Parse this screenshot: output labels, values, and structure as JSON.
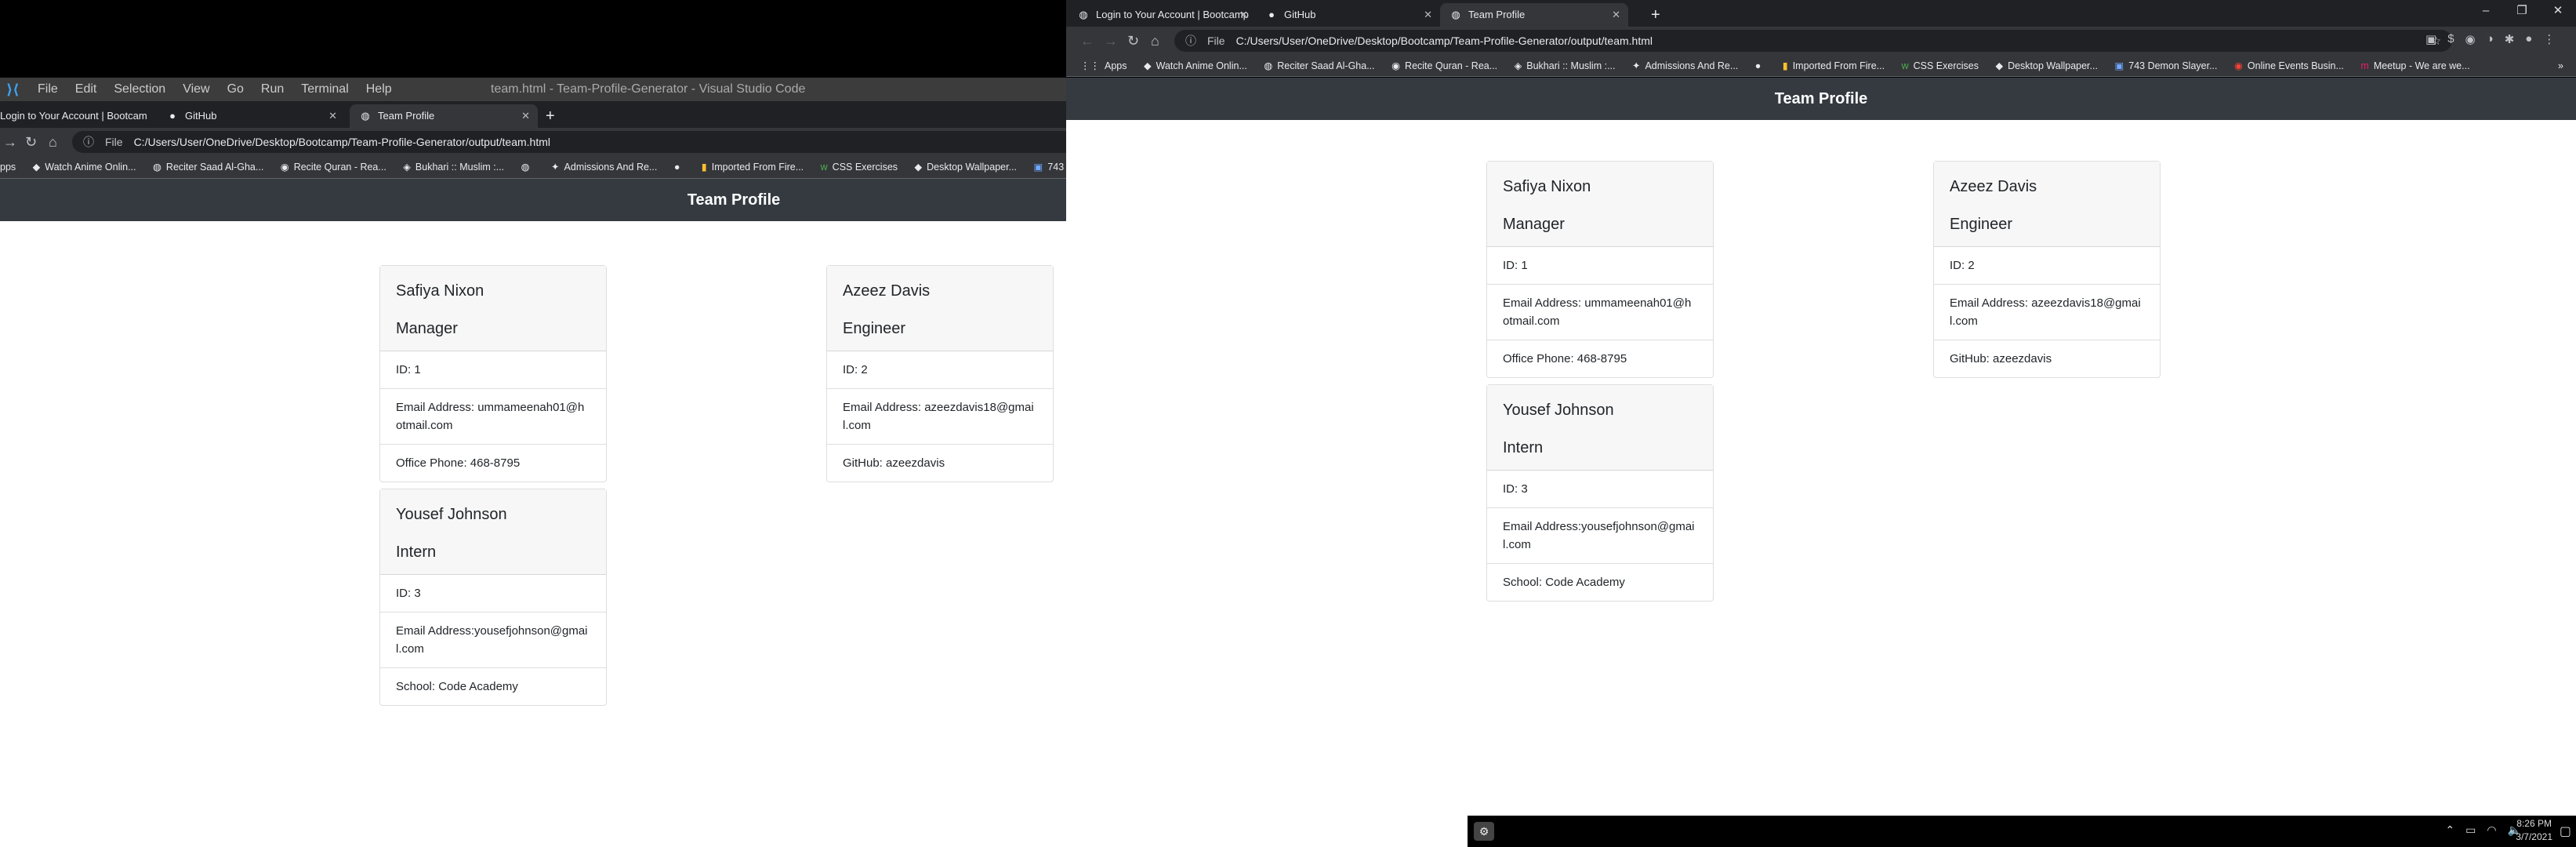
{
  "vscode": {
    "menu": [
      "File",
      "Edit",
      "Selection",
      "View",
      "Go",
      "Run",
      "Terminal",
      "Help"
    ],
    "title": "team.html - Team-Profile-Generator - Visual Studio Code"
  },
  "browser": {
    "tabs": [
      {
        "label": "Login to Your Account | Bootcamp",
        "icon": "bootcamp-icon"
      },
      {
        "label": "GitHub",
        "icon": "github-icon"
      },
      {
        "label": "Team Profile",
        "icon": "globe-icon"
      }
    ],
    "url_scheme": "File",
    "url": "C:/Users/User/OneDrive/Desktop/Bootcamp/Team-Profile-Generator/output/team.html",
    "bookmarks": [
      "Apps",
      "Watch Anime Onlin...",
      "Reciter Saad Al-Gha...",
      "Recite Quran - Rea...",
      "Bukhari :: Muslim :...",
      "",
      "Admissions And Re...",
      "",
      "Imported From Fire...",
      "CSS Exercises",
      "Desktop Wallpaper...",
      "743 Demon Slayer...",
      "Online Events Busin...",
      "Meetup - We are we..."
    ]
  },
  "page": {
    "header": "Team Profile",
    "cards": [
      {
        "name": "Safiya Nixon",
        "role": "Manager",
        "id": "ID: 1",
        "email": "Email Address: ummameenah01@hotmail.com",
        "extra": "Office Phone: 468-8795"
      },
      {
        "name": "Azeez Davis",
        "role": "Engineer",
        "id": "ID: 2",
        "email": "Email Address: azeezdavis18@gmail.com",
        "extra": "GitHub: azeezdavis"
      },
      {
        "name": "Yousef Johnson",
        "role": "Intern",
        "id": "ID: 3",
        "email": "Email Address:yousefjohnson@gmail.com",
        "extra": "School: Code Academy"
      }
    ]
  },
  "taskbar": {
    "time": "8:26 PM",
    "date": "3/7/2021"
  }
}
